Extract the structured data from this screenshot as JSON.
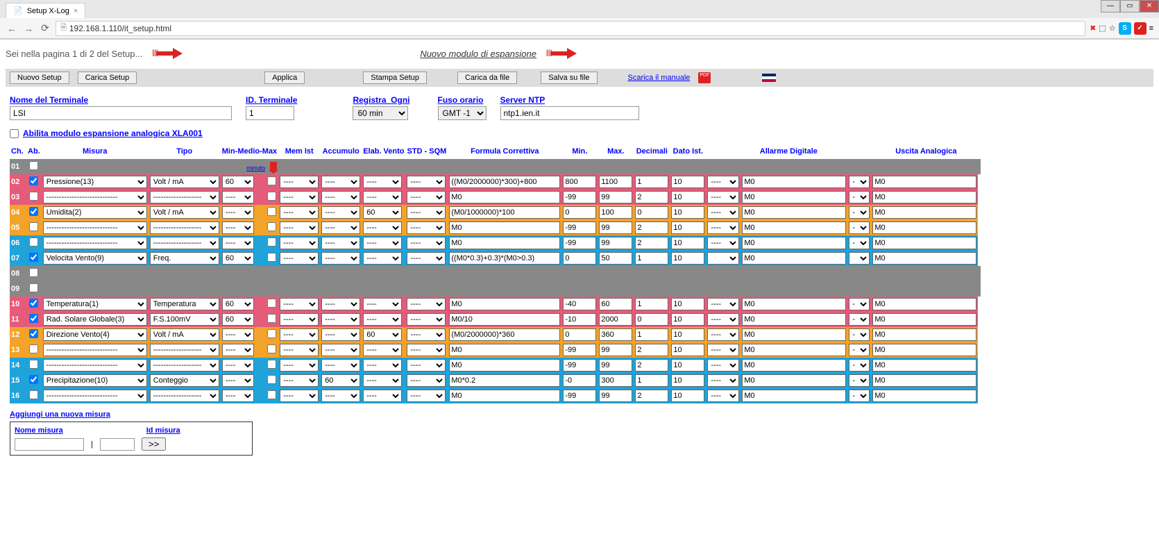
{
  "browser": {
    "tab_title": "Setup X-Log",
    "url": "192.168.1.110/it_setup.html"
  },
  "banner": {
    "page_text": "Sei nella pagina 1 di 2 del Setup...",
    "expansion_link": "Nuovo modulo di espansione"
  },
  "toolbar": {
    "nuovo_setup": "Nuovo Setup",
    "carica_setup": "Carica Setup",
    "applica": "Applica",
    "stampa_setup": "Stampa Setup",
    "carica_da_file": "Carica da file",
    "salva_su_file": "Salva su file",
    "scarica_manuale": "Scarica il manuale"
  },
  "fields": {
    "nome_terminale_label": "Nome del Terminale",
    "nome_terminale_value": "LSI",
    "id_terminale_label": "ID. Terminale",
    "id_terminale_value": "1",
    "registra_ogni_label": "Registra_Ogni",
    "registra_ogni_value": "60 min",
    "fuso_orario_label": "Fuso orario",
    "fuso_orario_value": "GMT -1",
    "server_ntp_label": "Server NTP",
    "server_ntp_value": "ntp1.ien.it"
  },
  "enable_analog": {
    "label": "Abilita modulo espansione analogica XLA001"
  },
  "columns": {
    "ch": "Ch.",
    "ab": "Ab.",
    "misura": "Misura",
    "tipo": "Tipo",
    "mmm": "Min-Medio-Max",
    "memist": "Mem Ist",
    "accumulo": "Accumulo",
    "elabvento": "Elab. Vento",
    "stdsqm": "STD - SQM",
    "formula": "Formula Correttiva",
    "min": "Min.",
    "max": "Max.",
    "decimali": "Decimali",
    "datoist": "Dato Ist.",
    "allarme": "Allarme Digitale",
    "uscita": "Uscita Analogica",
    "minuto": "minuto"
  },
  "rows": [
    {
      "ch": "01",
      "color": "gray",
      "enabled": false,
      "empty": true
    },
    {
      "ch": "02",
      "color": "pink",
      "enabled": true,
      "misura": "Pressione(13)",
      "tipo": "Volt / mA",
      "mmm": "60",
      "acc": "----",
      "ev": "----",
      "std": "----",
      "sqm": "----",
      "formula": "((M0/2000000)*300)+800",
      "min": "800",
      "max": "1100",
      "dec": "1",
      "ist": "10",
      "alarm": "----",
      "mo1": "M0",
      "dash": "-",
      "mo2": "M0"
    },
    {
      "ch": "03",
      "color": "pink",
      "enabled": false,
      "misura": "----------------------------",
      "tipo": "-------------------",
      "mmm": "----",
      "acc": "----",
      "ev": "----",
      "std": "----",
      "sqm": "----",
      "formula": "M0",
      "min": "-99",
      "max": "99",
      "dec": "2",
      "ist": "10",
      "alarm": "----",
      "mo1": "M0",
      "dash": "-",
      "mo2": "M0"
    },
    {
      "ch": "04",
      "color": "orange",
      "enabled": true,
      "misura": "Umidita(2)",
      "tipo": "Volt / mA",
      "mmm": "----",
      "acc": "----",
      "ev": "----",
      "std": "60",
      "sqm": "----",
      "formula": "(M0/1000000)*100",
      "min": "0",
      "max": "100",
      "dec": "0",
      "ist": "10",
      "alarm": "----",
      "mo1": "M0",
      "dash": "-",
      "mo2": "M0"
    },
    {
      "ch": "05",
      "color": "orange",
      "enabled": false,
      "misura": "----------------------------",
      "tipo": "-------------------",
      "mmm": "----",
      "acc": "----",
      "ev": "----",
      "std": "----",
      "sqm": "----",
      "formula": "M0",
      "min": "-99",
      "max": "99",
      "dec": "2",
      "ist": "10",
      "alarm": "----",
      "mo1": "M0",
      "dash": "-",
      "mo2": "M0"
    },
    {
      "ch": "06",
      "color": "cyan",
      "enabled": false,
      "misura": "----------------------------",
      "tipo": "-------------------",
      "mmm": "----",
      "acc": "----",
      "ev": "----",
      "std": "----",
      "sqm": "----",
      "formula": "M0",
      "min": "-99",
      "max": "99",
      "dec": "2",
      "ist": "10",
      "alarm": "----",
      "mo1": "M0",
      "dash": "-",
      "mo2": "M0"
    },
    {
      "ch": "07",
      "color": "cyan",
      "enabled": true,
      "misura": "Velocita Vento(9)",
      "tipo": "Freq.",
      "mmm": "60",
      "acc": "----",
      "ev": "----",
      "std": "----",
      "sqm": "----",
      "formula": "((M0*0.3)+0.3)*(M0>0.3)",
      "min": "0",
      "max": "50",
      "dec": "1",
      "ist": "10",
      "alarm": "",
      "mo1": "M0",
      "dash": "",
      "mo2": "M0"
    },
    {
      "ch": "08",
      "color": "gray",
      "enabled": false,
      "empty": true
    },
    {
      "ch": "09",
      "color": "gray",
      "enabled": false,
      "empty": true
    },
    {
      "ch": "10",
      "color": "pink",
      "enabled": true,
      "misura": "Temperatura(1)",
      "tipo": "Temperatura",
      "mmm": "60",
      "acc": "----",
      "ev": "----",
      "std": "----",
      "sqm": "----",
      "formula": "M0",
      "min": "-40",
      "max": "60",
      "dec": "1",
      "ist": "10",
      "alarm": "----",
      "mo1": "M0",
      "dash": "-",
      "mo2": "M0"
    },
    {
      "ch": "11",
      "color": "pink",
      "enabled": true,
      "misura": "Rad. Solare Globale(3)",
      "tipo": "F.S.100mV",
      "mmm": "60",
      "acc": "----",
      "ev": "----",
      "std": "----",
      "sqm": "----",
      "formula": "M0/10",
      "min": "-10",
      "max": "2000",
      "dec": "0",
      "ist": "10",
      "alarm": "----",
      "mo1": "M0",
      "dash": "-",
      "mo2": "M0"
    },
    {
      "ch": "12",
      "color": "orange",
      "enabled": true,
      "misura": "Direzione Vento(4)",
      "tipo": "Volt / mA",
      "mmm": "----",
      "acc": "----",
      "ev": "----",
      "std": "60",
      "sqm": "----",
      "formula": "(M0/2000000)*360",
      "min": "0",
      "max": "360",
      "dec": "1",
      "ist": "10",
      "alarm": "----",
      "mo1": "M0",
      "dash": "-",
      "mo2": "M0"
    },
    {
      "ch": "13",
      "color": "orange",
      "enabled": false,
      "misura": "----------------------------",
      "tipo": "-------------------",
      "mmm": "----",
      "acc": "----",
      "ev": "----",
      "std": "----",
      "sqm": "----",
      "formula": "M0",
      "min": "-99",
      "max": "99",
      "dec": "2",
      "ist": "10",
      "alarm": "----",
      "mo1": "M0",
      "dash": "-",
      "mo2": "M0"
    },
    {
      "ch": "14",
      "color": "cyan",
      "enabled": false,
      "misura": "----------------------------",
      "tipo": "-------------------",
      "mmm": "----",
      "acc": "----",
      "ev": "----",
      "std": "----",
      "sqm": "----",
      "formula": "M0",
      "min": "-99",
      "max": "99",
      "dec": "2",
      "ist": "10",
      "alarm": "----",
      "mo1": "M0",
      "dash": "-",
      "mo2": "M0"
    },
    {
      "ch": "15",
      "color": "cyan",
      "enabled": true,
      "misura": "Precipitazione(10)",
      "tipo": "Conteggio",
      "mmm": "----",
      "acc": "----",
      "ev": "60",
      "std": "----",
      "sqm": "----",
      "formula": "M0*0.2",
      "min": "-0",
      "max": "300",
      "dec": "1",
      "ist": "10",
      "alarm": "----",
      "mo1": "M0",
      "dash": "-",
      "mo2": "M0"
    },
    {
      "ch": "16",
      "color": "cyan",
      "enabled": false,
      "misura": "----------------------------",
      "tipo": "-------------------",
      "mmm": "----",
      "acc": "----",
      "ev": "----",
      "std": "----",
      "sqm": "----",
      "formula": "M0",
      "min": "-99",
      "max": "99",
      "dec": "2",
      "ist": "10",
      "alarm": "----",
      "mo1": "M0",
      "dash": "-",
      "mo2": "M0"
    }
  ],
  "add_measure": {
    "link": "Aggiungi una nuova misura",
    "nome_label": "Nome misura",
    "id_label": "Id misura",
    "button": ">>"
  }
}
